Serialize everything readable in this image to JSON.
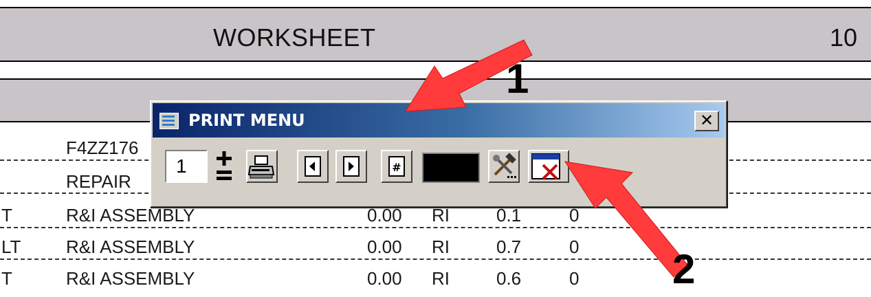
{
  "worksheet": {
    "title": "WORKSHEET",
    "number": "10"
  },
  "rows": [
    {
      "a": "",
      "b": "F4ZZ176",
      "c": "",
      "d": "",
      "e": "",
      "f": ""
    },
    {
      "a": "",
      "b": "REPAIR",
      "c": "",
      "d": "",
      "e": "",
      "f": ""
    },
    {
      "a": "T",
      "b": "R&I ASSEMBLY",
      "c": "0.00",
      "d": "RI",
      "e": "0.1",
      "f": "0"
    },
    {
      "a": "LT",
      "b": "R&I ASSEMBLY",
      "c": "0.00",
      "d": "RI",
      "e": "0.7",
      "f": "0"
    },
    {
      "a": "T",
      "b": "R&I ASSEMBLY",
      "c": "0.00",
      "d": "RI",
      "e": "0.6",
      "f": "0"
    }
  ],
  "dialog": {
    "title": "PRINT MENU",
    "close_label": "✕",
    "copies": "1",
    "buttons": [
      "print-icon",
      "previous-page-icon",
      "next-page-icon",
      "page-number-icon",
      "tools-icon",
      "close-form-icon"
    ],
    "color_swatch": "#000000"
  },
  "callouts": {
    "one": "1",
    "two": "2"
  },
  "colors": {
    "arrow": "#ff3b3b",
    "band": "#c8c4c8",
    "titlebar_start": "#0a246a"
  }
}
